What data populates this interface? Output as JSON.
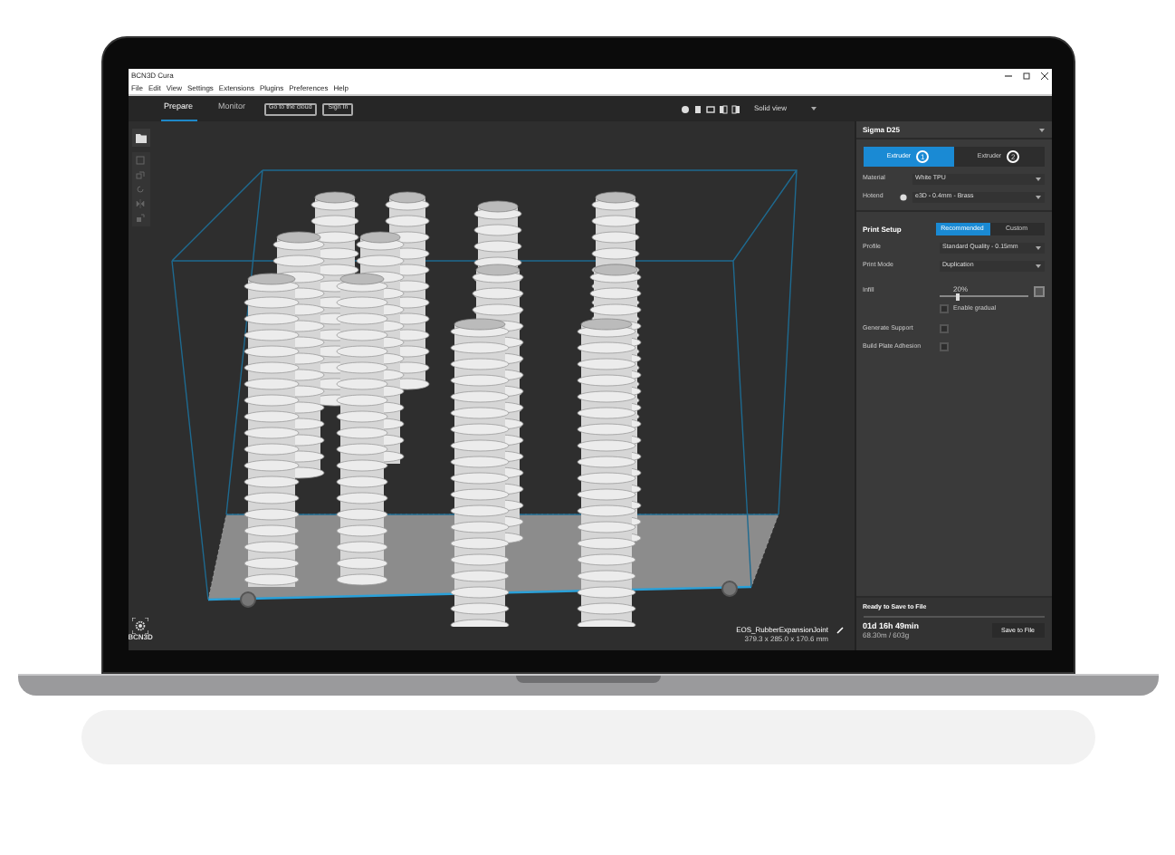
{
  "window": {
    "title": "BCN3D Cura"
  },
  "menu": [
    "File",
    "Edit",
    "View",
    "Settings",
    "Extensions",
    "Plugins",
    "Preferences",
    "Help"
  ],
  "tabs": [
    {
      "label": "Prepare",
      "selected": true
    },
    {
      "label": "Monitor",
      "selected": false
    }
  ],
  "toolbar_buttons": [
    "Go to the cloud",
    "Sign In"
  ],
  "view_mode": "Solid view",
  "printer": {
    "name": "Sigma D25"
  },
  "extruders": [
    {
      "label": "Extruder",
      "number": "1",
      "selected": true
    },
    {
      "label": "Extruder",
      "number": "2",
      "selected": false
    }
  ],
  "material": {
    "label": "Material",
    "value": "White TPU"
  },
  "hotend": {
    "label": "Hotend",
    "value": "e3D - 0.4mm - Brass"
  },
  "print_setup": {
    "title": "Print Setup",
    "modes": [
      {
        "label": "Recommended",
        "selected": true
      },
      {
        "label": "Custom",
        "selected": false
      }
    ],
    "profile": {
      "label": "Profile",
      "value": "Standard Quality - 0.15mm"
    },
    "print_mode": {
      "label": "Print Mode",
      "value": "Duplication"
    },
    "infill": {
      "label": "Infill",
      "reading": "20%",
      "level": 0.2,
      "gradual": {
        "label": "Enable gradual",
        "checked": false
      }
    },
    "options": [
      {
        "label": "Generate Support",
        "checked": false
      },
      {
        "label": "Build Plate Adhesion",
        "checked": false
      }
    ]
  },
  "footer": {
    "status": "Ready to Save to File",
    "time": "01d 16h 49min",
    "usage": "68.30m / 603g",
    "button": "Save to File"
  },
  "object": {
    "name": "EOS_RubberExpansionJoint",
    "dimensions": "379.3 x 285.0 x 170.6 mm"
  },
  "logo": {
    "text": "BCN3D"
  }
}
